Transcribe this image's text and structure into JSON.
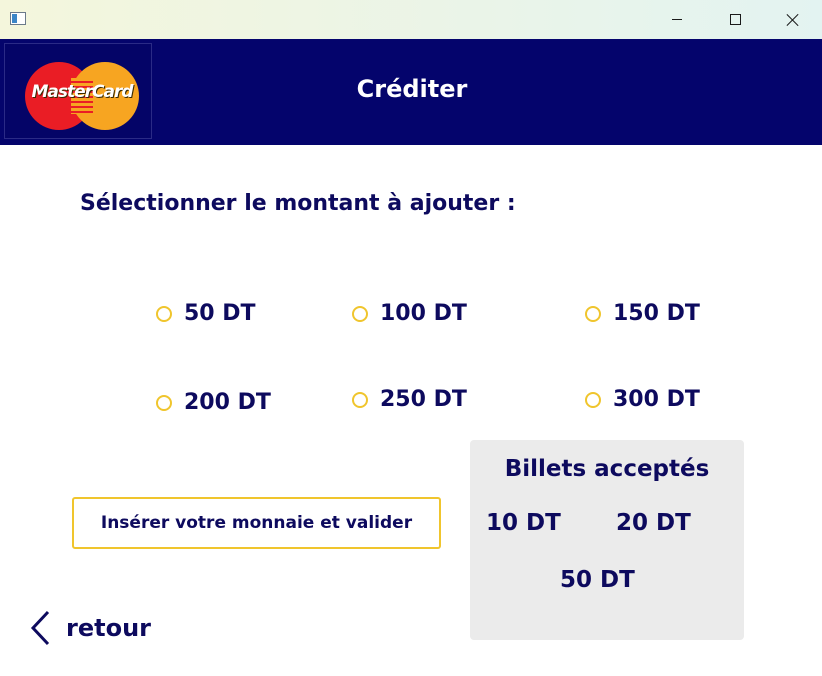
{
  "window": {
    "controls": {
      "minimize_icon": "minimize-icon",
      "maximize_icon": "maximize-icon",
      "close_icon": "close-icon"
    }
  },
  "header": {
    "logo_text": "MasterCard",
    "title": "Créditer",
    "background_color": "#04046c"
  },
  "main": {
    "prompt": "Sélectionner le montant à ajouter :",
    "amounts": [
      {
        "label": "50 DT"
      },
      {
        "label": "100 DT"
      },
      {
        "label": "150 DT"
      },
      {
        "label": "200 DT"
      },
      {
        "label": "250 DT"
      },
      {
        "label": "300 DT"
      }
    ],
    "insert_button_label": "Insérer votre monnaie et valider",
    "accent_color": "#f0c52d"
  },
  "accepted_notes": {
    "title": "Billets acceptés",
    "notes": [
      "10 DT",
      "20 DT",
      "50 DT"
    ]
  },
  "back": {
    "label": "retour",
    "icon": "chevron-left-icon"
  }
}
